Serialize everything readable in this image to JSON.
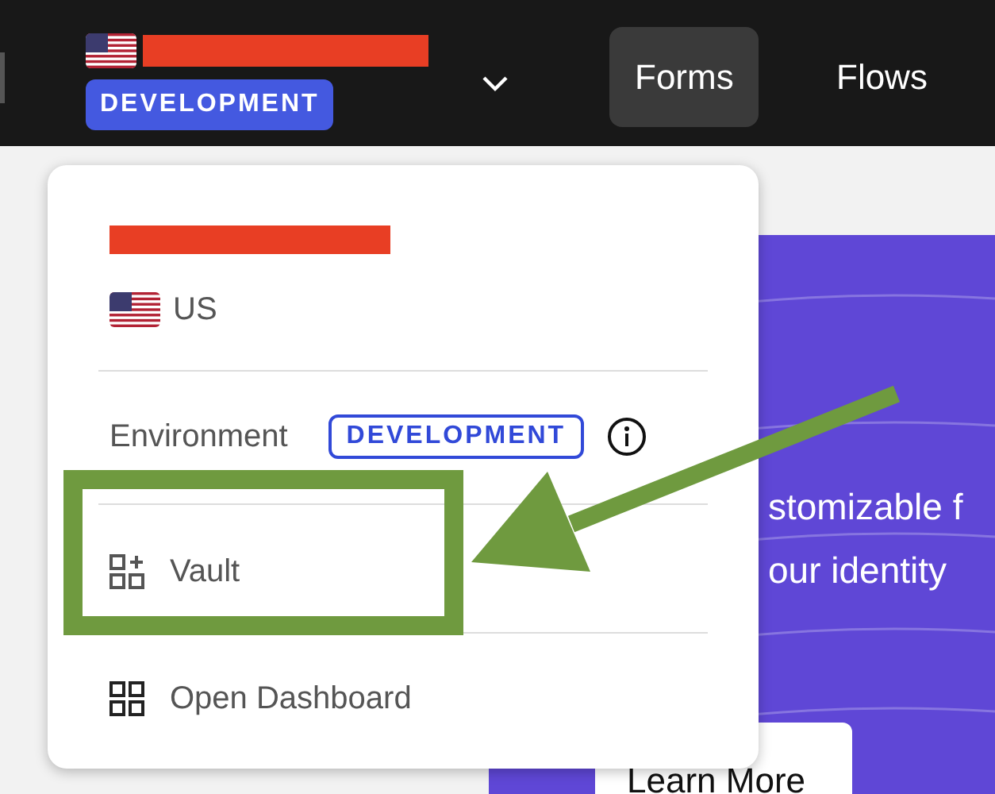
{
  "header": {
    "environment_badge": "DEVELOPMENT",
    "nav": [
      {
        "label": "Forms",
        "selected": true
      },
      {
        "label": "Flows",
        "selected": false
      }
    ]
  },
  "hero": {
    "lines": [
      "stomizable f",
      "our identity"
    ],
    "button": "Learn More"
  },
  "menu": {
    "region": "US",
    "environment_label": "Environment",
    "environment_badge": "DEVELOPMENT",
    "items": [
      {
        "label": "Vault",
        "kind": "vault",
        "highlighted": true
      },
      {
        "label": "Open Dashboard",
        "kind": "dashboard",
        "highlighted": false
      }
    ]
  }
}
